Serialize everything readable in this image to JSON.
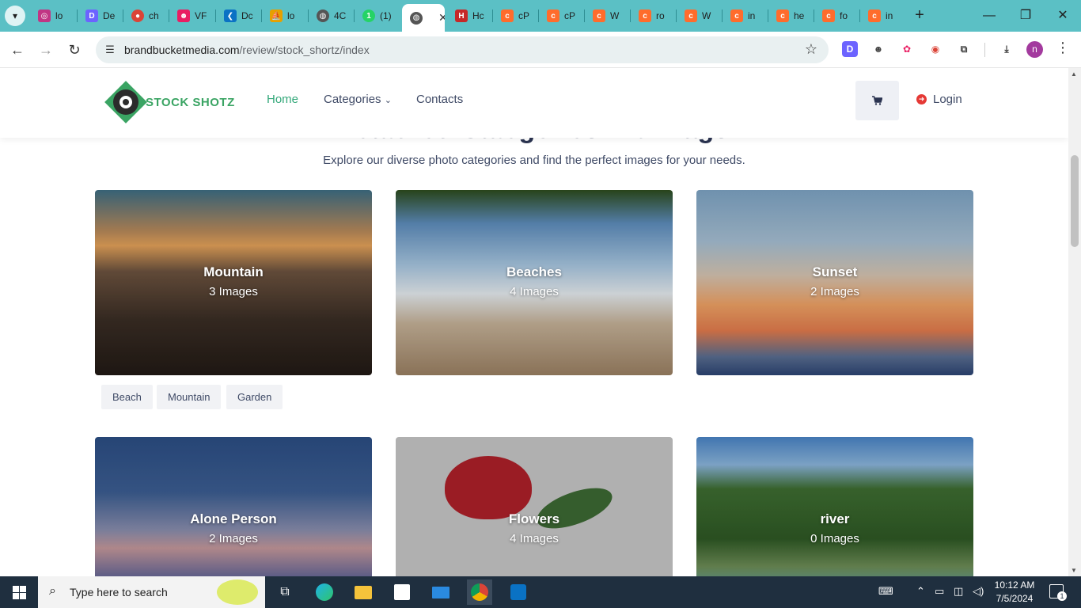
{
  "browser": {
    "tabs": [
      {
        "label": "lo",
        "icon": "instagram-icon",
        "color": "#c13584"
      },
      {
        "label": "De",
        "icon": "d-icon",
        "color": "#6c63ff"
      },
      {
        "label": "ch",
        "icon": "chrome-icon",
        "color": "#db4437"
      },
      {
        "label": "VF",
        "icon": "robot-icon",
        "color": "#e91e63"
      },
      {
        "label": "Dc",
        "icon": "vscode-icon",
        "color": "#0a72c4"
      },
      {
        "label": "lo",
        "icon": "pma-icon",
        "color": "#e6a000"
      },
      {
        "label": "4C",
        "icon": "globe-icon",
        "color": "#555555"
      },
      {
        "label": "(1)",
        "icon": "whatsapp-icon",
        "color": "#25d366"
      },
      {
        "label": "",
        "icon": "globe-icon",
        "color": "#555555",
        "active": true
      },
      {
        "label": "Hc",
        "icon": "h-icon",
        "color": "#c62828"
      },
      {
        "label": "cP",
        "icon": "cpanel-icon",
        "color": "#ff6c2c"
      },
      {
        "label": "cP",
        "icon": "cpanel-icon",
        "color": "#ff6c2c"
      },
      {
        "label": "W",
        "icon": "cpanel-icon",
        "color": "#ff6c2c"
      },
      {
        "label": "ro",
        "icon": "cpanel-icon",
        "color": "#ff6c2c"
      },
      {
        "label": "W",
        "icon": "cpanel-icon",
        "color": "#ff6c2c"
      },
      {
        "label": "in",
        "icon": "cpanel-icon",
        "color": "#ff6c2c"
      },
      {
        "label": "he",
        "icon": "cpanel-icon",
        "color": "#ff6c2c"
      },
      {
        "label": "fo",
        "icon": "cpanel-icon",
        "color": "#ff6c2c"
      },
      {
        "label": "in",
        "icon": "cpanel-icon",
        "color": "#ff6c2c"
      }
    ],
    "url_domain": "brandbucketmedia.com",
    "url_path": "/review/stock_shortz/index",
    "profile_initial": "n"
  },
  "site": {
    "logo_text": "STOCK SHOTZ",
    "nav": {
      "home": "Home",
      "categories": "Categories",
      "contacts": "Contacts",
      "login": "Login"
    },
    "section_title": "Featured Categories with Tags",
    "subtitle": "Explore our diverse photo categories and find the perfect images for your needs.",
    "cards": [
      {
        "title": "Mountain",
        "count": "3 Images"
      },
      {
        "title": "Beaches",
        "count": "4 Images"
      },
      {
        "title": "Sunset",
        "count": "2 Images"
      },
      {
        "title": "Alone Person",
        "count": "2 Images"
      },
      {
        "title": "Flowers",
        "count": "4 Images"
      },
      {
        "title": "river",
        "count": "0 Images"
      }
    ],
    "tags": [
      "Beach",
      "Mountain",
      "Garden"
    ],
    "accent_color": "#34a87a"
  },
  "taskbar": {
    "search_placeholder": "Type here to search",
    "time": "10:12 AM",
    "date": "7/5/2024",
    "notification_count": "1"
  }
}
